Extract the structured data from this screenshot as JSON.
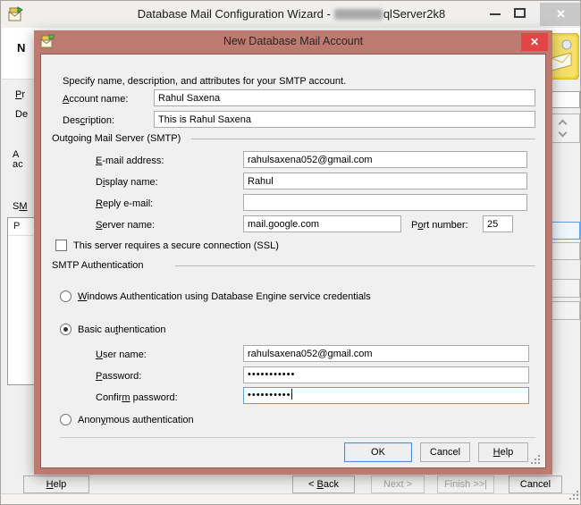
{
  "titlebar": {
    "title_prefix": "Database Mail Configuration Wizard -",
    "title_suffix": "qlServer2k8",
    "close_glyph": "✕"
  },
  "wizard": {
    "heading_fragment": "N",
    "profile_fragment": {
      "t": "Pr",
      "u": 0
    },
    "description_fragment": "De",
    "info_fragment_line1": "A",
    "info_fragment_line2": "ac",
    "smtp_accounts_fragment": {
      "t": "SM",
      "u": 1
    },
    "list_header_fragment": "P",
    "help": {
      "t": "Help",
      "u": 0
    },
    "back": {
      "t": "< Back",
      "u": 2
    },
    "next": "Next >",
    "finish": "Finish >>|",
    "cancel": "Cancel"
  },
  "dialog": {
    "title": "New Database Mail Account",
    "close_glyph": "✕",
    "intro": "Specify name, description, and attributes for your SMTP account.",
    "account_name": {
      "label": {
        "t": "Account name:",
        "u": 0
      },
      "value": "Rahul Saxena"
    },
    "description": {
      "label": {
        "t": "Description:",
        "u": 3
      },
      "value": "This is Rahul Saxena"
    },
    "smtp": {
      "group_title": "Outgoing Mail Server (SMTP)",
      "email": {
        "label": {
          "t": "E-mail address:",
          "u": 0
        },
        "value": "rahulsaxena052@gmail.com"
      },
      "display_name": {
        "label": {
          "t": "Display name:",
          "u": 1
        },
        "value": "Rahul"
      },
      "reply": {
        "label": {
          "t": "Reply e-mail:",
          "u": 0
        },
        "value": ""
      },
      "server": {
        "label": {
          "t": "Server name:",
          "u": 0
        },
        "value": "mail.google.com"
      },
      "port": {
        "label": {
          "t": "Port number:",
          "u": 1
        },
        "value": "25"
      },
      "ssl_label": "This server requires a secure connection (SSL)",
      "ssl_checked": false
    },
    "auth": {
      "group_title": "SMTP Authentication",
      "windows_label": {
        "t": "Windows Authentication using Database Engine service credentials",
        "u": 0
      },
      "basic_label": {
        "t": "Basic authentication",
        "u": 8
      },
      "user": {
        "label": {
          "t": "User name:",
          "u": 0
        },
        "value": "rahulsaxena052@gmail.com"
      },
      "password": {
        "label": {
          "t": "Password:",
          "u": 0
        },
        "value": "•••••••••••"
      },
      "confirm": {
        "label": {
          "t": "Confirm password:",
          "u": 6
        },
        "value": "••••••••••"
      },
      "anonymous_label": {
        "t": "Anonymous authentication",
        "u": 4
      },
      "selected_option": "basic"
    },
    "ok": "OK",
    "cancel": "Cancel",
    "help": {
      "t": "Help",
      "u": 0
    }
  },
  "colors": {
    "dialog_frame": "#bd7a70",
    "dialog_close_red": "#e34444",
    "focus_blue": "#5e9ee3",
    "window_bg": "#f0f0f0",
    "header_bg": "#ffffff",
    "big_icon_yellow": "#f0d33c"
  }
}
